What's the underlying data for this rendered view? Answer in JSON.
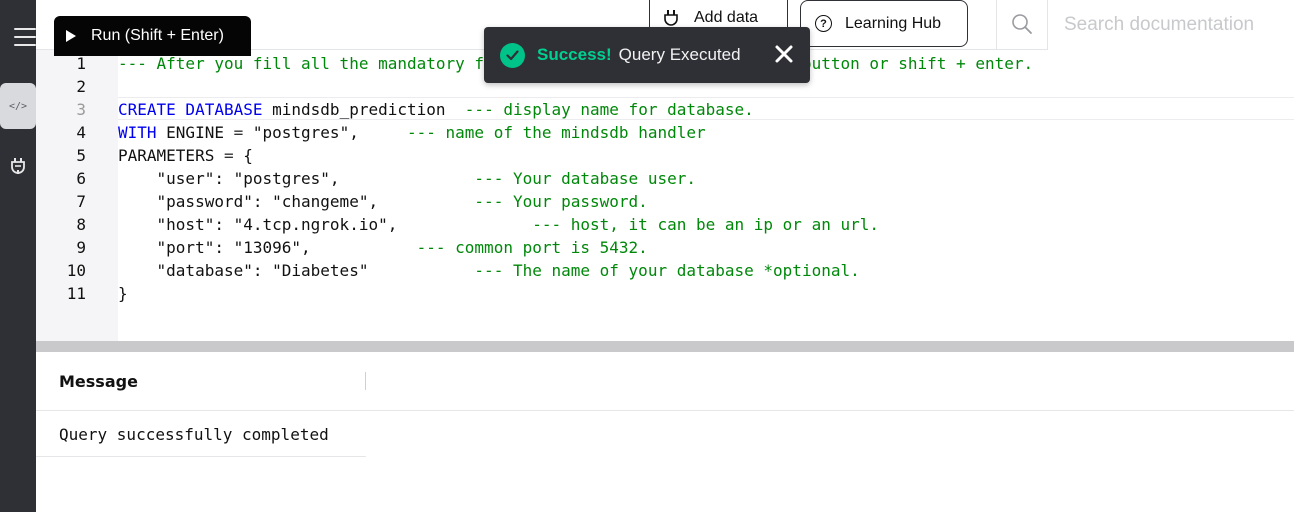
{
  "toolbar": {
    "run_label": "Run (Shift + Enter)",
    "add_data_label": "Add data",
    "learning_hub_label": "Learning Hub",
    "search_placeholder": "Search documentation"
  },
  "toast": {
    "title": "Success!",
    "message": "Query Executed"
  },
  "editor": {
    "line_numbers": [
      "1",
      "2",
      "3",
      "4",
      "5",
      "6",
      "7",
      "8",
      "9",
      "10",
      "11"
    ],
    "lines": [
      [
        {
          "t": "cm",
          "v": "--- After you fill all the mandatory fields run the query with the top button or shift + enter."
        }
      ],
      [],
      [
        {
          "t": "kw",
          "v": "CREATE DATABASE"
        },
        {
          "t": "tx",
          "v": " mindsdb_prediction  "
        },
        {
          "t": "cm",
          "v": "--- display name for database."
        }
      ],
      [
        {
          "t": "kw",
          "v": "WITH"
        },
        {
          "t": "tx",
          "v": " ENGINE "
        },
        {
          "t": "op",
          "v": "="
        },
        {
          "t": "tx",
          "v": " \"postgres\",     "
        },
        {
          "t": "cm",
          "v": "--- name of the mindsdb handler"
        }
      ],
      [
        {
          "t": "tx",
          "v": "PARAMETERS "
        },
        {
          "t": "op",
          "v": "="
        },
        {
          "t": "tx",
          "v": " {"
        }
      ],
      [
        {
          "t": "tx",
          "v": "    \"user\": \"postgres\",              "
        },
        {
          "t": "cm",
          "v": "--- Your database user."
        }
      ],
      [
        {
          "t": "tx",
          "v": "    \"password\": \"changeme\",          "
        },
        {
          "t": "cm",
          "v": "--- Your password."
        }
      ],
      [
        {
          "t": "tx",
          "v": "    \"host\": \"4.tcp.ngrok.io\",              "
        },
        {
          "t": "cm",
          "v": "--- host, it can be an ip or an url."
        }
      ],
      [
        {
          "t": "tx",
          "v": "    \"port\": \"13096\",           "
        },
        {
          "t": "cm",
          "v": "--- common port is 5432."
        }
      ],
      [
        {
          "t": "tx",
          "v": "    \"database\": \"Diabetes\"           "
        },
        {
          "t": "cm",
          "v": "--- The name of your database *optional."
        }
      ],
      [
        {
          "t": "tx",
          "v": "}"
        }
      ]
    ]
  },
  "results": {
    "column": "Message",
    "rows": [
      "Query successfully completed"
    ]
  },
  "colors": {
    "sidebar": "#2f3035",
    "success": "#00d092",
    "keyword": "#0000ee",
    "comment": "#00880a"
  },
  "icons": {
    "menu": "hamburger-icon",
    "sql_editor": "code-icon",
    "integrations": "plug-icon",
    "play": "play-icon",
    "help": "question-icon",
    "search": "search-icon",
    "success": "check-circle-icon",
    "close": "close-icon"
  }
}
